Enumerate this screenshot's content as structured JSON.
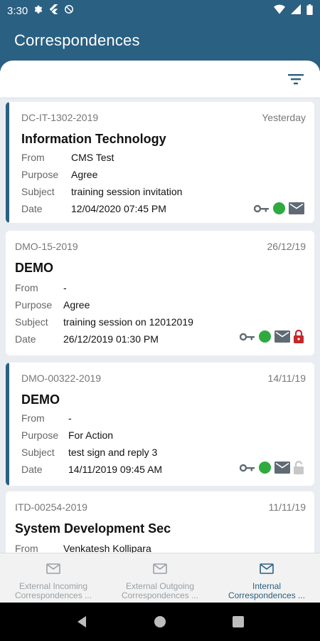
{
  "status_bar": {
    "time": "3:30",
    "left_icons": [
      "gear-icon",
      "flutter-icon",
      "at-sign-icon"
    ],
    "right_icons": [
      "wifi-icon",
      "signal-icon",
      "battery-icon"
    ]
  },
  "header": {
    "title": "Correspondences"
  },
  "filter": {
    "icon": "filter-icon"
  },
  "cards": [
    {
      "ref": "DC-IT-1302-2019",
      "date": "Yesterday",
      "title": "Information Technology",
      "from_label": "From",
      "from": "CMS Test",
      "purpose_label": "Purpose",
      "purpose": "Agree",
      "subject_label": "Subject",
      "subject": "training session invitation",
      "date_label": "Date",
      "datetime": "12/04/2020 07:45 PM",
      "unread": true,
      "icons": [
        "key-icon",
        "green-dot-icon",
        "mail-icon"
      ]
    },
    {
      "ref": "DMO-15-2019",
      "date": "26/12/19",
      "title": "DEMO",
      "from_label": "From",
      "from": "-",
      "purpose_label": "Purpose",
      "purpose": "Agree",
      "subject_label": "Subject",
      "subject": "training session on 12012019",
      "date_label": "Date",
      "datetime": "26/12/2019 01:30 PM",
      "unread": false,
      "icons": [
        "key-icon",
        "green-dot-icon",
        "mail-icon",
        "lock-closed-icon"
      ]
    },
    {
      "ref": "DMO-00322-2019",
      "date": "14/11/19",
      "title": "DEMO",
      "from_label": "From",
      "from": "-",
      "purpose_label": "Purpose",
      "purpose": "For Action",
      "subject_label": "Subject",
      "subject": "test sign and reply 3",
      "date_label": "Date",
      "datetime": "14/11/2019 09:45 AM",
      "unread": true,
      "icons": [
        "key-icon",
        "green-dot-icon",
        "mail-icon",
        "lock-open-icon"
      ]
    },
    {
      "ref": "ITD-00254-2019",
      "date": "11/11/19",
      "title": "System Development Sec",
      "from_label": "From",
      "from": "Venkatesh Kollipara",
      "unread": false
    }
  ],
  "bottom_nav": [
    {
      "label": "External Incoming\nCorrespondences ...",
      "icon": "mail-icon",
      "active": false
    },
    {
      "label": "External Outgoing\nCorrespondences ...",
      "icon": "mail-icon",
      "active": false
    },
    {
      "label": "Internal\nCorrespondences ...",
      "icon": "mail-icon",
      "active": true
    }
  ],
  "colors": {
    "primary": "#2a6082",
    "green_status": "#2eaa3f",
    "lock_red": "#c62828",
    "lock_inactive": "#c7c7c7"
  }
}
